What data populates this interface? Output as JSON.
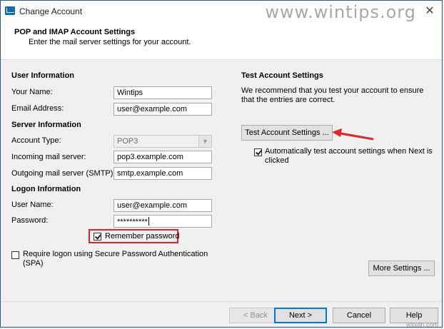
{
  "window": {
    "title": "Change Account",
    "close_glyph": "✕"
  },
  "watermark": "www.wintips.org",
  "header": {
    "title": "POP and IMAP Account Settings",
    "subtitle": "Enter the mail server settings for your account."
  },
  "user_info": {
    "title": "User Information",
    "your_name_label": "Your Name:",
    "your_name_value": "Wintips",
    "email_label": "Email Address:",
    "email_value": "user@example.com"
  },
  "server_info": {
    "title": "Server Information",
    "account_type_label": "Account Type:",
    "account_type_value": "POP3",
    "incoming_label": "Incoming mail server:",
    "incoming_value": "pop3.example.com",
    "outgoing_label": "Outgoing mail server (SMTP):",
    "outgoing_value": "smtp.example.com"
  },
  "logon_info": {
    "title": "Logon Information",
    "user_name_label": "User Name:",
    "user_name_value": "user@example.com",
    "password_label": "Password:",
    "password_value": "**********",
    "remember_label": "Remember password",
    "remember_checked": true,
    "spa_label": "Require logon using Secure Password Authentication (SPA)",
    "spa_checked": false
  },
  "test_settings": {
    "title": "Test Account Settings",
    "description": "We recommend that you test your account to ensure that the entries are correct.",
    "button_label": "Test Account Settings ...",
    "auto_test_label": "Automatically test account settings when Next is clicked",
    "auto_test_checked": true,
    "more_settings_label": "More Settings ..."
  },
  "footer": {
    "back_label": "< Back",
    "next_label": "Next >",
    "cancel_label": "Cancel",
    "help_label": "Help"
  },
  "colors": {
    "highlight": "#e0252b",
    "accent": "#0078d7"
  }
}
